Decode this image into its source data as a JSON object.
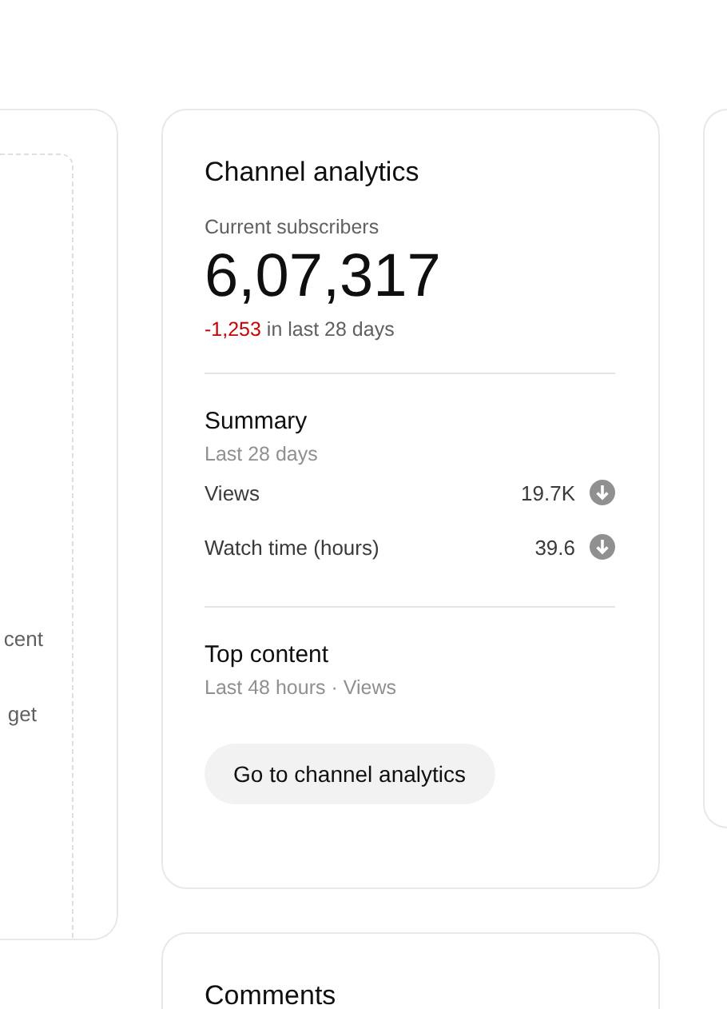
{
  "left_card": {
    "texts": [
      "cent",
      "get"
    ]
  },
  "channel_analytics": {
    "title": "Channel analytics",
    "subscribers_label": "Current subscribers",
    "subscribers": "6,07,317",
    "change": "-1,253",
    "change_suffix": "in last 28 days",
    "summary": {
      "title": "Summary",
      "period": "Last 28 days",
      "metrics": [
        {
          "label": "Views",
          "value": "19.7K",
          "kind": "down"
        },
        {
          "label": "Watch time (hours)",
          "value": "39.6",
          "kind": "down"
        }
      ]
    },
    "top_content": {
      "title": "Top content",
      "subtitle": "Last 48 hours · Views"
    },
    "button": "Go to channel analytics"
  },
  "comments": {
    "title": "Comments"
  }
}
